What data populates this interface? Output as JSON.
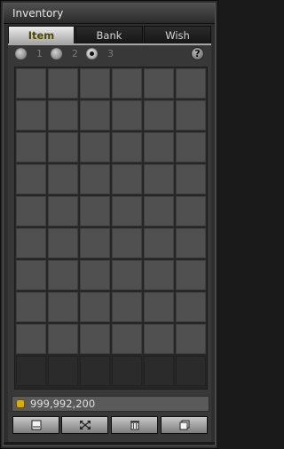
{
  "window": {
    "title": "Inventory"
  },
  "tabs": [
    {
      "label": "Item",
      "active": true
    },
    {
      "label": "Bank",
      "active": false
    },
    {
      "label": "Wish",
      "active": false
    }
  ],
  "pages": [
    {
      "label": "1",
      "selected": false
    },
    {
      "label": "2",
      "selected": false
    },
    {
      "label": "3",
      "selected": true
    }
  ],
  "help": {
    "label": "?"
  },
  "grid": {
    "columns": 6,
    "rows": 10,
    "unlocked_rows": 9
  },
  "money": {
    "amount": "999,992,200",
    "icon": "gold-coin-icon"
  },
  "toolbar": [
    {
      "name": "sort-button",
      "icon": "window-icon"
    },
    {
      "name": "expand-button",
      "icon": "expand-arrows-icon"
    },
    {
      "name": "trash-button",
      "icon": "trash-icon"
    },
    {
      "name": "stack-button",
      "icon": "stack-icon"
    }
  ],
  "colors": {
    "accent_tab_text": "#4a4a00",
    "slot": "#505050",
    "coin": "#d9b000"
  }
}
